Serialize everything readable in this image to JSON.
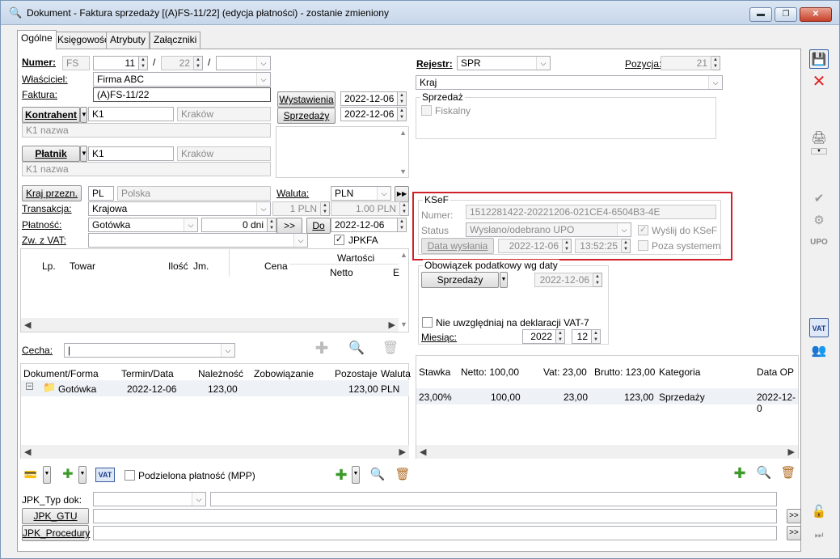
{
  "window": {
    "title": "Dokument - Faktura sprzedaży [(A)FS-11/22] (edycja płatności) - zostanie zmieniony",
    "min": "▬",
    "max": "❐",
    "close": "✕"
  },
  "tabs": [
    "Ogólne",
    "Księgowość",
    "Atrybuty",
    "Załączniki"
  ],
  "left": {
    "numer_label": "Numer:",
    "numer_type": "FS",
    "numer_no": "11",
    "numer_year": "22",
    "sep": "/",
    "wlasciciel_label": "Właściciel:",
    "wlasciciel": "Firma ABC",
    "faktura_label": "Faktura:",
    "faktura": "(A)FS-11/22",
    "wystawienia_btn": "Wystawienia",
    "wystawienia_date": "2022-12-06",
    "sprzedazy_btn": "Sprzedaży",
    "sprzedazy_date": "2022-12-06",
    "kontrahent_btn": "Kontrahent",
    "kontrahent_code": "K1",
    "kontrahent_city": "Kraków",
    "kontrahent_name": "K1 nazwa",
    "platnik_btn": "Płatnik",
    "platnik_code": "K1",
    "platnik_city": "Kraków",
    "platnik_name": "K1 nazwa",
    "kraj_btn": "Kraj przezn.",
    "kraj_code": "PL",
    "kraj_name": "Polska",
    "waluta_label": "Waluta:",
    "waluta": "PLN",
    "transakcja_label": "Transakcja:",
    "transakcja": "Krajowa",
    "kurs1": "1 PLN",
    "kurs2": "1.00 PLN",
    "platnosc_label": "Płatność:",
    "platnosc": "Gotówka",
    "dni": "0 dni",
    "arrow_btn": ">>",
    "do_btn": "Do",
    "platnosc_date": "2022-12-06",
    "zwvat_label": "Zw. z VAT:",
    "zwvat": "",
    "jpkfa": "JPKFA",
    "cecha_label": "Cecha:",
    "cecha": "|"
  },
  "items_table": {
    "headers": [
      "Lp.",
      "Towar",
      "Ilość",
      "Jm.",
      "Cena",
      "Wartości",
      "Netto",
      "E"
    ]
  },
  "payments_table": {
    "headers": [
      "Dokument/Forma",
      "Termin/Data",
      "Należność",
      "Zobowiązanie",
      "Pozostaje",
      "Waluta"
    ],
    "rows": [
      {
        "doc": "Gotówka",
        "date": "2022-12-06",
        "naleznosc": "123,00",
        "zobowiazanie": "",
        "pozostaje": "123,00",
        "waluta": "PLN"
      }
    ]
  },
  "right": {
    "rejestr_label": "Rejestr:",
    "rejestr": "SPR",
    "pozycja_label": "Pozycja:",
    "pozycja": "21",
    "kraj": "Kraj",
    "sprzedaz_legend": "Sprzedaż",
    "fiskalny": "Fiskalny",
    "ksef_legend": "KSeF",
    "ksef_numer_label": "Numer:",
    "ksef_numer": "1512281422-20221206-021CE4-6504B3-4E",
    "ksef_status_label": "Status",
    "ksef_status": "Wysłano/odebrano UPO",
    "wyslij": "Wyślij do KSeF",
    "data_wyslania_btn": "Data wysłania",
    "data_wyslania": "2022-12-06",
    "czas_wyslania": "13:52:25",
    "poza": "Poza systemem",
    "obowiazek_legend": "Obowiązek podatkowy wg daty",
    "obowiazek_btn": "Sprzedaży",
    "obowiazek_date": "2022-12-06",
    "nie_uwzgledniaj": "Nie uwzględniaj na deklaracji VAT-7",
    "miesiac_label": "Miesiąc:",
    "miesiac_year": "2022",
    "miesiac_month": "12"
  },
  "vat_table": {
    "headers": [
      "Stawka",
      "Netto: 100,00",
      "Vat: 23,00",
      "Brutto: 123,00",
      "Kategoria",
      "Data OP"
    ],
    "rows": [
      {
        "stawka": "23,00%",
        "netto": "100,00",
        "vat": "23,00",
        "brutto": "123,00",
        "kategoria": "Sprzedaży",
        "data": "2022-12-0"
      }
    ]
  },
  "bottom": {
    "vat_icon": "VAT",
    "mpp": "Podzielona płatność (MPP)",
    "jpk_typ_label": "JPK_Typ dok:",
    "jpk_gtu_btn": "JPK_GTU",
    "jpk_proc_btn": "JPK_Procedury",
    "more": ">>"
  },
  "side": {
    "upo": "UPO",
    "vat": "VAT"
  }
}
